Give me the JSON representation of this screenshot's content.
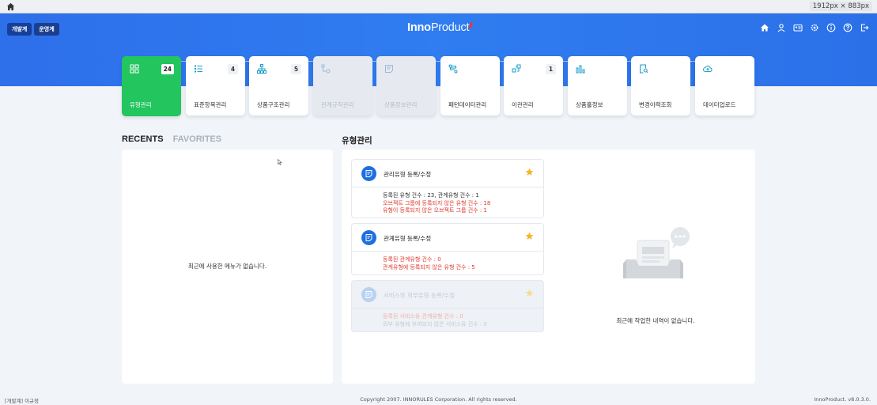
{
  "browser": {
    "dimensions": "1912px × 883px"
  },
  "header": {
    "env_buttons": [
      "개발계",
      "운영계"
    ],
    "logo_bold": "Inno",
    "logo_thin": "Product",
    "icons": [
      "home-icon",
      "user-icon",
      "id-card-icon",
      "settings-icon",
      "info-icon",
      "help-icon",
      "logout-icon"
    ]
  },
  "stepper": {
    "current_index": 0,
    "count": 10
  },
  "cards": [
    {
      "label": "유형관리",
      "count": "24",
      "icon": "grid-icon",
      "state": "active"
    },
    {
      "label": "표준항목관리",
      "count": "4",
      "icon": "list-icon",
      "state": "normal"
    },
    {
      "label": "상품구조관리",
      "count": "5",
      "icon": "hierarchy-icon",
      "state": "normal"
    },
    {
      "label": "관계규칙관리",
      "count": "",
      "icon": "relation-rule-icon",
      "state": "disabled"
    },
    {
      "label": "상품정보관리",
      "count": "",
      "icon": "product-info-icon",
      "state": "disabled"
    },
    {
      "label": "패턴데이터관리",
      "count": "",
      "icon": "pattern-icon",
      "state": "normal"
    },
    {
      "label": "이관관리",
      "count": "1",
      "icon": "transfer-icon",
      "state": "normal"
    },
    {
      "label": "상품흘정보",
      "count": "",
      "icon": "bar-chart-icon",
      "state": "normal"
    },
    {
      "label": "변경이력조회",
      "count": "",
      "icon": "history-search-icon",
      "state": "normal"
    },
    {
      "label": "데이터업로드",
      "count": "",
      "icon": "cloud-upload-icon",
      "state": "normal"
    }
  ],
  "recents": {
    "tab_recents": "RECENTS",
    "tab_favorites": "FAVORITES",
    "empty_message": "최근에 사용한 메뉴가 없습니다."
  },
  "type_section": {
    "title": "유형관리",
    "items": [
      {
        "title": "관리유형 등록/수정",
        "starred": true,
        "state": "normal",
        "lines": [
          {
            "text": "등록된 유형 건수 : 23, 관계유형 건수 : 1",
            "tone": "normal"
          },
          {
            "text": "오브젝트 그룹에 등록되지 않은 유형 건수 : 18",
            "tone": "red"
          },
          {
            "text": "유형이 등록되지 않은 오브젝트 그룹 건수 : 1",
            "tone": "red"
          }
        ]
      },
      {
        "title": "관계유형 등록/수정",
        "starred": true,
        "state": "normal",
        "lines": [
          {
            "text": "등록된 관계유형 건수 : 0",
            "tone": "red"
          },
          {
            "text": "관계유형에 등록되지 않은 유형 건수 : 5",
            "tone": "red"
          }
        ]
      },
      {
        "title": "서비스와 외부유형 등록/수정",
        "starred": false,
        "state": "disabled",
        "lines": [
          {
            "text": "등록된 서비스유 관계유형 건수 : 0",
            "tone": "red"
          },
          {
            "text": "외부 유형에 부여되지 않은 서비스유 건수 : 0",
            "tone": "normal"
          }
        ]
      }
    ],
    "work_empty_message": "최근에 작업한 내역이 없습니다."
  },
  "footer": {
    "left": "[개발계] 이규정",
    "center": "Copyright 2007. INNORULES Corporation. All rights reserved.",
    "right": "InnoProduct. v8.0.3.0."
  },
  "colors": {
    "header_blue": "#2f7df0",
    "active_green": "#22c55e",
    "accent_blue": "#1e6fe0",
    "warning_red": "#e03a2f",
    "star_gold": "#f2b524"
  }
}
